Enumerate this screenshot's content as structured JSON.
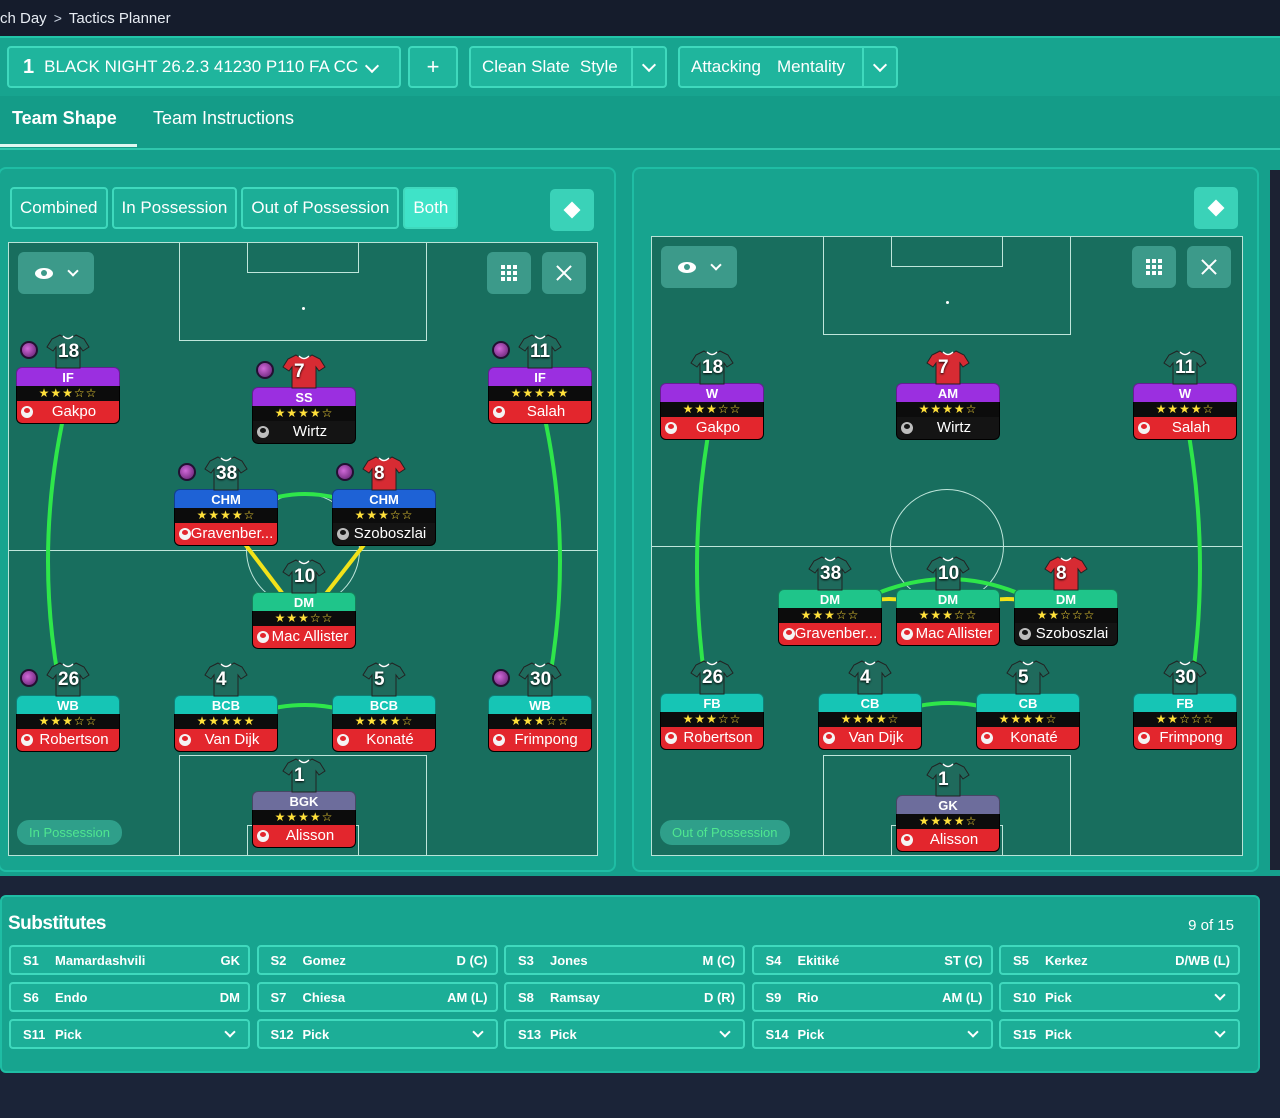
{
  "breadcrumb": {
    "parent": "ch Day",
    "current": "Tactics Planner"
  },
  "toolbar": {
    "tactic_number": "1",
    "tactic_name": "BLACK NIGHT 26.2.3 41230 P110 FA CC",
    "add_label": "+",
    "style_value": "Clean Slate",
    "style_label": "Style",
    "mentality_value": "Attacking",
    "mentality_label": "Mentality"
  },
  "tabs": {
    "team_shape": "Team Shape",
    "team_instructions": "Team Instructions"
  },
  "filters": {
    "combined": "Combined",
    "in_possession": "In Possession",
    "out_of_possession": "Out of Possession",
    "both": "Both"
  },
  "left_pitch": {
    "label": "In Possession",
    "players": [
      {
        "num": "18",
        "role": "IF",
        "stars": "★★★☆☆",
        "name": "Gakpo"
      },
      {
        "num": "7",
        "role": "SS",
        "stars": "★★★★☆",
        "name": "Wirtz"
      },
      {
        "num": "11",
        "role": "IF",
        "stars": "★★★★★",
        "name": "Salah"
      },
      {
        "num": "38",
        "role": "CHM",
        "stars": "★★★★☆",
        "name": "Gravenber..."
      },
      {
        "num": "8",
        "role": "CHM",
        "stars": "★★★☆☆",
        "name": "Szoboszlai"
      },
      {
        "num": "10",
        "role": "DM",
        "stars": "★★★☆☆",
        "name": "Mac Allister"
      },
      {
        "num": "26",
        "role": "WB",
        "stars": "★★★☆☆",
        "name": "Robertson"
      },
      {
        "num": "4",
        "role": "BCB",
        "stars": "★★★★★",
        "name": "Van Dijk"
      },
      {
        "num": "5",
        "role": "BCB",
        "stars": "★★★★☆",
        "name": "Konaté"
      },
      {
        "num": "30",
        "role": "WB",
        "stars": "★★★☆☆",
        "name": "Frimpong"
      },
      {
        "num": "1",
        "role": "BGK",
        "stars": "★★★★☆",
        "name": "Alisson"
      }
    ]
  },
  "right_pitch": {
    "label": "Out of Possession",
    "players": [
      {
        "num": "18",
        "role": "W",
        "stars": "★★★☆☆",
        "name": "Gakpo"
      },
      {
        "num": "7",
        "role": "AM",
        "stars": "★★★★☆",
        "name": "Wirtz"
      },
      {
        "num": "11",
        "role": "W",
        "stars": "★★★★☆",
        "name": "Salah"
      },
      {
        "num": "38",
        "role": "DM",
        "stars": "★★★☆☆",
        "name": "Gravenber..."
      },
      {
        "num": "10",
        "role": "DM",
        "stars": "★★★☆☆",
        "name": "Mac Allister"
      },
      {
        "num": "8",
        "role": "DM",
        "stars": "★★☆☆☆",
        "name": "Szoboszlai"
      },
      {
        "num": "26",
        "role": "FB",
        "stars": "★★★☆☆",
        "name": "Robertson"
      },
      {
        "num": "4",
        "role": "CB",
        "stars": "★★★★☆",
        "name": "Van Dijk"
      },
      {
        "num": "5",
        "role": "CB",
        "stars": "★★★★☆",
        "name": "Konaté"
      },
      {
        "num": "30",
        "role": "FB",
        "stars": "★★☆☆☆",
        "name": "Frimpong"
      },
      {
        "num": "1",
        "role": "GK",
        "stars": "★★★★☆",
        "name": "Alisson"
      }
    ]
  },
  "substitutes": {
    "title": "Substitutes",
    "count": "9 of 15",
    "slots": [
      {
        "slot": "S1",
        "name": "Mamardashvili",
        "pos": "GK"
      },
      {
        "slot": "S2",
        "name": "Gomez",
        "pos": "D (C)"
      },
      {
        "slot": "S3",
        "name": "Jones",
        "pos": "M (C)"
      },
      {
        "slot": "S4",
        "name": "Ekitiké",
        "pos": "ST (C)"
      },
      {
        "slot": "S5",
        "name": "Kerkez",
        "pos": "D/WB (L)"
      },
      {
        "slot": "S6",
        "name": "Endo",
        "pos": "DM"
      },
      {
        "slot": "S7",
        "name": "Chiesa",
        "pos": "AM (L)"
      },
      {
        "slot": "S8",
        "name": "Ramsay",
        "pos": "D (R)"
      },
      {
        "slot": "S9",
        "name": "Rio",
        "pos": "AM (L)"
      },
      {
        "slot": "S10",
        "name": "Pick",
        "pos": ""
      },
      {
        "slot": "S11",
        "name": "Pick",
        "pos": ""
      },
      {
        "slot": "S12",
        "name": "Pick",
        "pos": ""
      },
      {
        "slot": "S13",
        "name": "Pick",
        "pos": ""
      },
      {
        "slot": "S14",
        "name": "Pick",
        "pos": ""
      },
      {
        "slot": "S15",
        "name": "Pick",
        "pos": ""
      }
    ]
  },
  "colors": {
    "panel": "#17a48f",
    "pitch": "#186e5e",
    "link_green": "#2ee64a",
    "link_yellow": "#f2e21a",
    "name_red": "#e3262d"
  }
}
